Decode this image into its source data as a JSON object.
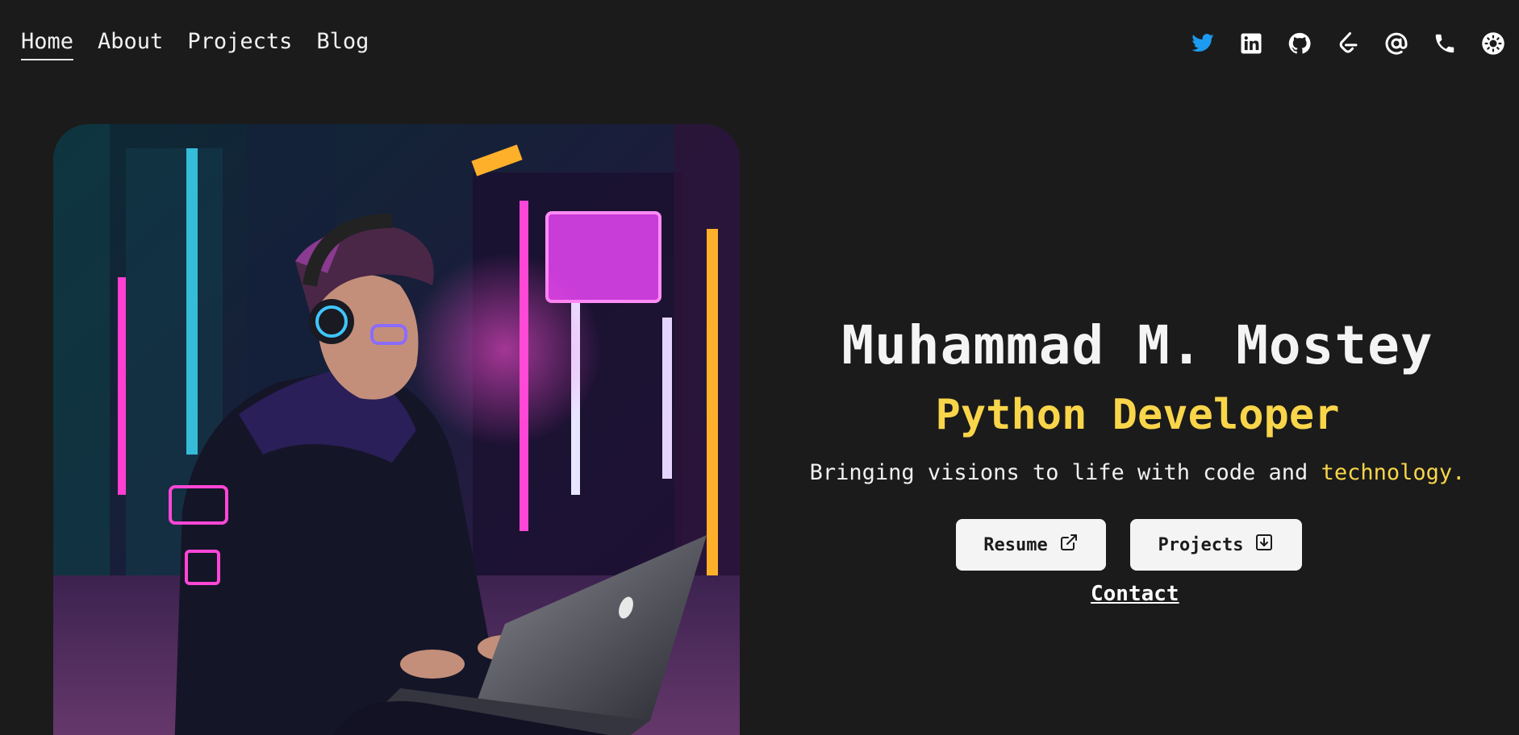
{
  "nav": {
    "items": [
      {
        "label": "Home",
        "active": true
      },
      {
        "label": "About"
      },
      {
        "label": "Projects"
      },
      {
        "label": "Blog"
      }
    ]
  },
  "socials": [
    {
      "icon": "twitter-icon",
      "color": "#1d9bf0"
    },
    {
      "icon": "linkedin-icon",
      "color": "#ffffff"
    },
    {
      "icon": "github-icon",
      "color": "#ffffff"
    },
    {
      "icon": "leetcode-icon",
      "color": "#ffffff"
    },
    {
      "icon": "email-at-icon",
      "color": "#ffffff"
    },
    {
      "icon": "phone-icon",
      "color": "#ffffff"
    },
    {
      "icon": "theme-toggle-sun-icon",
      "color": "#ffffff"
    }
  ],
  "hero": {
    "name": "Muhammad M. Mostey",
    "role": "Python Developer",
    "tagline_prefix": "Bringing visions to life with code and ",
    "tagline_highlight": "technology.",
    "buttons": {
      "resume": "Resume",
      "projects": "Projects"
    },
    "contact": "Contact",
    "image_alt": "developer-with-headphones-and-laptop-neon-city"
  },
  "colors": {
    "background": "#1b1b1b",
    "accent": "#f9d54a",
    "button_bg": "#f4f4f4"
  }
}
